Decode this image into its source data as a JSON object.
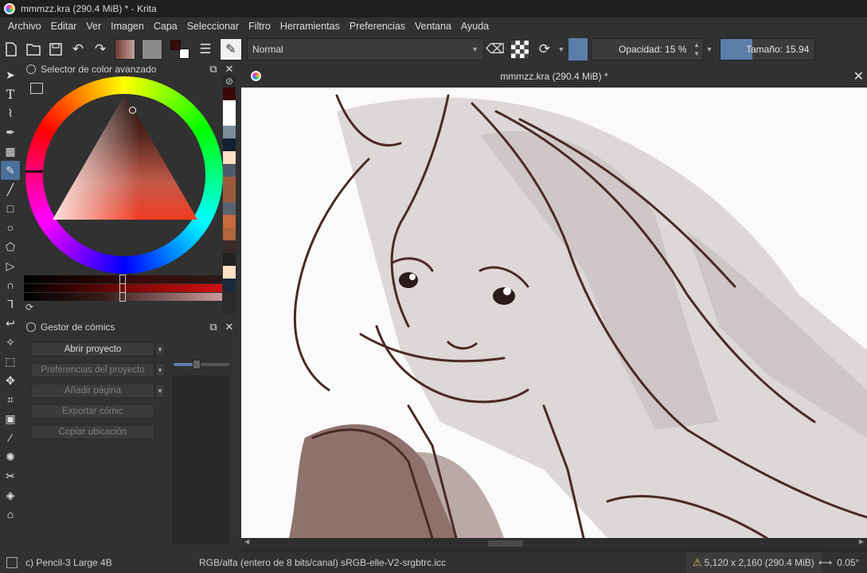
{
  "window": {
    "title": "mmmzz.kra (290.4 MiB) * - Krita"
  },
  "menu": [
    "Archivo",
    "Editar",
    "Ver",
    "Imagen",
    "Capa",
    "Seleccionar",
    "Filtro",
    "Herramientas",
    "Preferencias",
    "Ventana",
    "Ayuda"
  ],
  "toolbar": {
    "blend_mode": "Normal",
    "opacity_label": "Opacidad: 15 %",
    "opacity_value": 15,
    "size_label": "Tamaño: 15.94"
  },
  "color_selector": {
    "title": "Selector de color avanzado",
    "accent": "#4a6f9a"
  },
  "palette": [
    "#3a0a0a",
    "#ffffff",
    "#ffffff",
    "#7a8d99",
    "#102030",
    "#ffe0c4",
    "#4d5a6a",
    "#9c5a3c",
    "#9c5a3c",
    "#5a6470",
    "#c96b3c",
    "#b0653c",
    "#3a2a2a",
    "#202020",
    "#ffe0c4",
    "#1a2a3a"
  ],
  "comic_manager": {
    "title": "Gestor de cómics",
    "buttons": [
      {
        "label": "Abrir proyecto",
        "enabled": true
      },
      {
        "label": "Preferencias del proyecto",
        "enabled": false
      },
      {
        "label": "Añadir página",
        "enabled": false
      },
      {
        "label": "Exportar cómic",
        "enabled": false
      },
      {
        "label": "Copiar ubicación",
        "enabled": false
      }
    ]
  },
  "document": {
    "tab_title": "mmmzz.kra (290.4 MiB) *"
  },
  "status": {
    "brush": "c) Pencil-3 Large 4B",
    "color_info": "RGB/alfa (entero de 8 bits/canal)  sRGB-elle-V2-srgbtrc.icc",
    "dimensions": "5,120 x 2,160 (290.4 MiB)",
    "rotation": "0.05°"
  }
}
